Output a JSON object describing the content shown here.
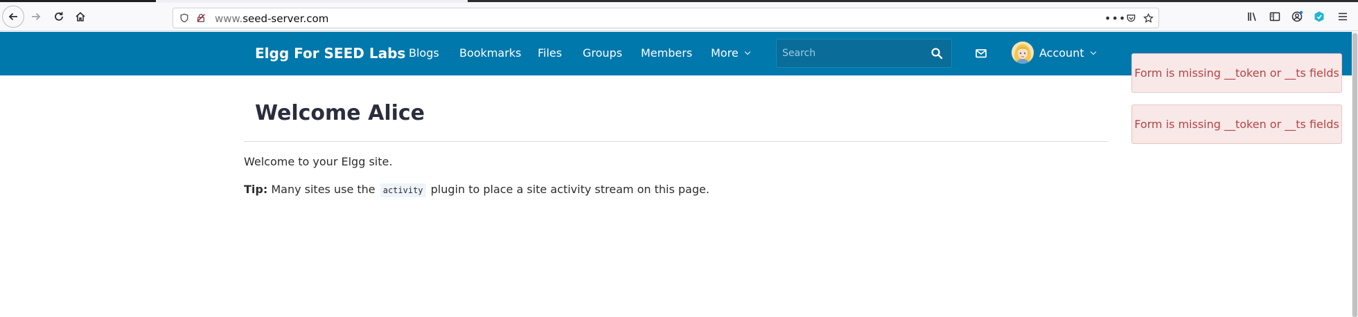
{
  "browser": {
    "url_prefix": "www.",
    "url_domain": "seed-server.com",
    "icons": [
      "back-icon",
      "forward-icon",
      "reload-icon",
      "home-icon",
      "shield-icon",
      "insecure-lock-icon",
      "more-icon",
      "pocket-icon",
      "star-icon",
      "library-icon",
      "sidebar-icon",
      "account-icon",
      "extension-icon",
      "menu-icon"
    ]
  },
  "site": {
    "brand": "Elgg For SEED Labs",
    "nav": {
      "blogs": "Blogs",
      "bookmarks": "Bookmarks",
      "files": "Files",
      "groups": "Groups",
      "members": "Members",
      "more": "More"
    },
    "search_placeholder": "Search",
    "account": "Account",
    "colors": {
      "topbar": "#0078ac",
      "error_bg": "#f8e8e8",
      "error_text": "#b64444"
    }
  },
  "main": {
    "title": "Welcome Alice",
    "welcome_text": "Welcome to your Elgg site.",
    "tip_label": "Tip:",
    "tip_before": "Many sites use the",
    "tip_code": "activity",
    "tip_after": "plugin to place a site activity stream on this page."
  },
  "messages": [
    "Form is missing __token or __ts fields",
    "Form is missing __token or __ts fields"
  ]
}
